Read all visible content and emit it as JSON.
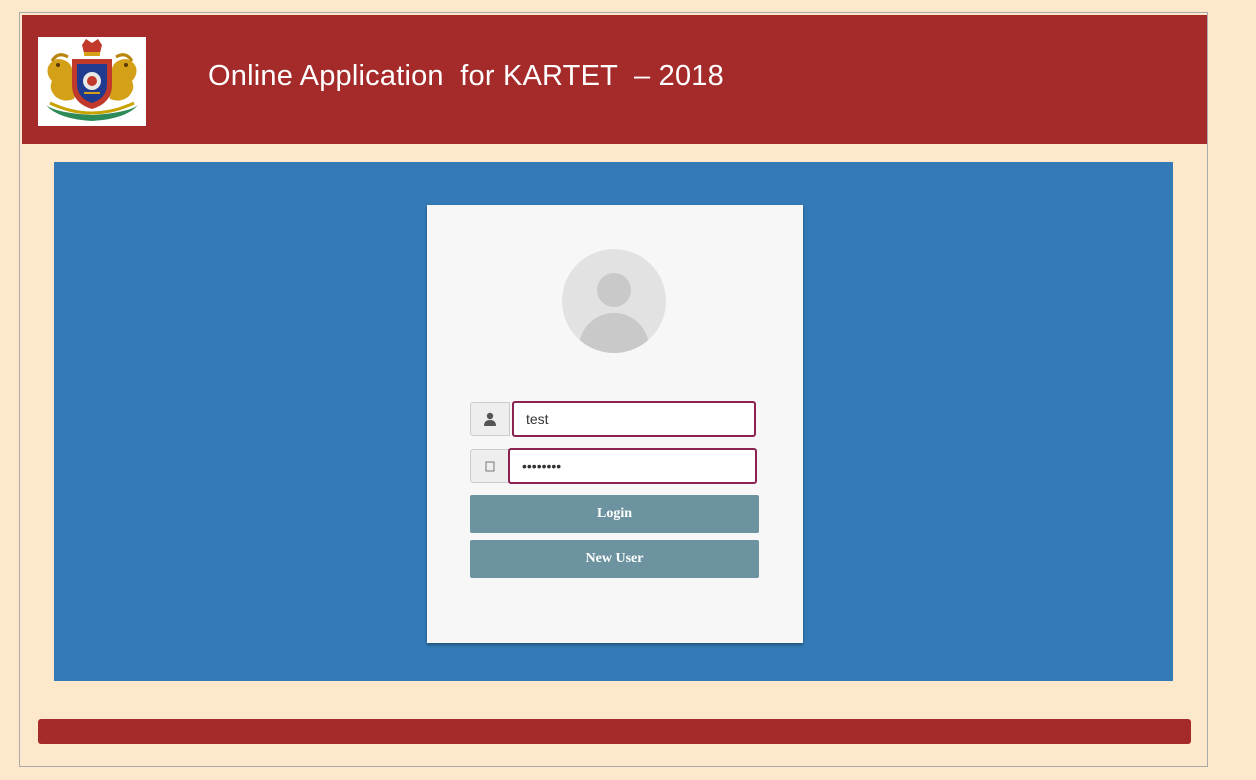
{
  "header": {
    "title": "Online Application  for KARTET  – 2018",
    "logo_icon": "karnataka-state-emblem"
  },
  "login": {
    "avatar_icon": "default-user-avatar",
    "username_icon": "user-icon",
    "password_icon": "lock-icon",
    "username_value": "test",
    "password_value": "••••••••",
    "login_label": "Login",
    "new_user_label": "New User"
  },
  "colors": {
    "page_background": "#fde8cb",
    "header_background": "#a52a2a",
    "panel_background": "#337ab7",
    "button_background": "#6c939f",
    "card_background": "#f7f7f7",
    "input_focus_border": "#8b2252"
  }
}
